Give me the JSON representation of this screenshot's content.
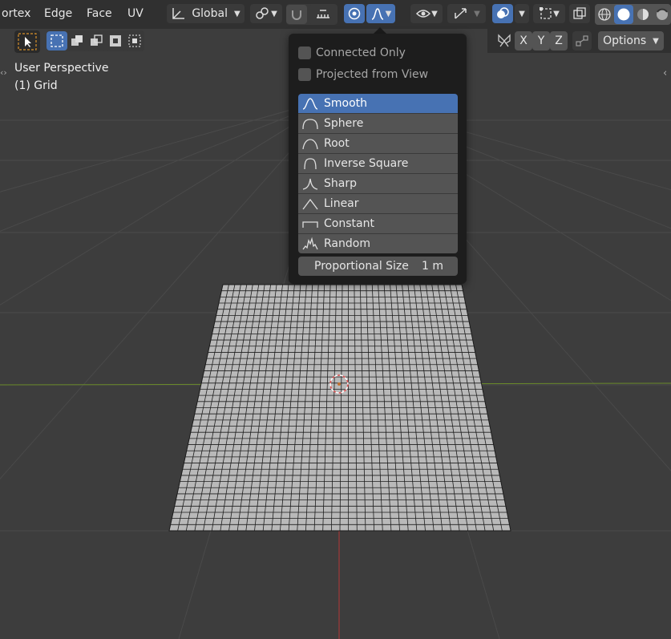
{
  "header": {
    "mode_menu": [
      "ortex",
      "Edge",
      "Face",
      "UV"
    ],
    "transform_orientation": "Global",
    "options_label": "Options",
    "axis_x": "X",
    "axis_y": "Y",
    "axis_z": "Z"
  },
  "viewport": {
    "perspective_label": "User Perspective",
    "object_label": "(1) Grid"
  },
  "proportional_popup": {
    "connected_only": "Connected Only",
    "projected_from_view": "Projected from View",
    "falloff_options": [
      {
        "label": "Smooth",
        "icon": "smooth-falloff-icon",
        "selected": true
      },
      {
        "label": "Sphere",
        "icon": "sphere-falloff-icon",
        "selected": false
      },
      {
        "label": "Root",
        "icon": "root-falloff-icon",
        "selected": false
      },
      {
        "label": "Inverse Square",
        "icon": "inverse-square-falloff-icon",
        "selected": false
      },
      {
        "label": "Sharp",
        "icon": "sharp-falloff-icon",
        "selected": false
      },
      {
        "label": "Linear",
        "icon": "linear-falloff-icon",
        "selected": false
      },
      {
        "label": "Constant",
        "icon": "constant-falloff-icon",
        "selected": false
      },
      {
        "label": "Random",
        "icon": "random-falloff-icon",
        "selected": false
      }
    ],
    "proportional_size_label": "Proportional Size",
    "proportional_size_value": "1 m"
  },
  "colors": {
    "header_bg": "#303030",
    "viewport_bg": "#3d3d3d",
    "accent_blue": "#4772b3",
    "x_axis": "#8b3a3a",
    "y_axis": "#6a8a2a",
    "mesh_face": "#b9b9b9",
    "mesh_edge": "#1a1a1a"
  }
}
